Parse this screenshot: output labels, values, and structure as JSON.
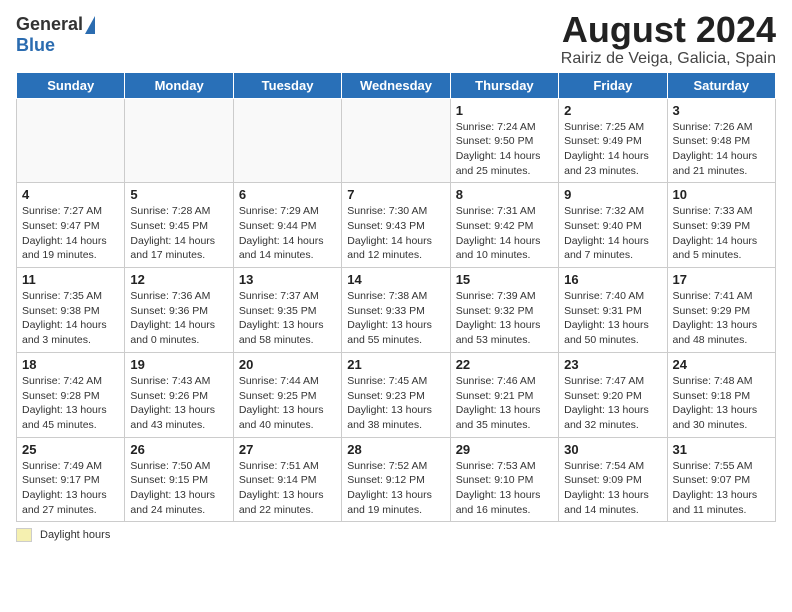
{
  "logo": {
    "general": "General",
    "blue": "Blue"
  },
  "title": "August 2024",
  "subtitle": "Rairiz de Veiga, Galicia, Spain",
  "weekdays": [
    "Sunday",
    "Monday",
    "Tuesday",
    "Wednesday",
    "Thursday",
    "Friday",
    "Saturday"
  ],
  "footer": {
    "daylight_label": "Daylight hours"
  },
  "weeks": [
    [
      {
        "day": "",
        "info": ""
      },
      {
        "day": "",
        "info": ""
      },
      {
        "day": "",
        "info": ""
      },
      {
        "day": "",
        "info": ""
      },
      {
        "day": "1",
        "info": "Sunrise: 7:24 AM\nSunset: 9:50 PM\nDaylight: 14 hours and 25 minutes."
      },
      {
        "day": "2",
        "info": "Sunrise: 7:25 AM\nSunset: 9:49 PM\nDaylight: 14 hours and 23 minutes."
      },
      {
        "day": "3",
        "info": "Sunrise: 7:26 AM\nSunset: 9:48 PM\nDaylight: 14 hours and 21 minutes."
      }
    ],
    [
      {
        "day": "4",
        "info": "Sunrise: 7:27 AM\nSunset: 9:47 PM\nDaylight: 14 hours and 19 minutes."
      },
      {
        "day": "5",
        "info": "Sunrise: 7:28 AM\nSunset: 9:45 PM\nDaylight: 14 hours and 17 minutes."
      },
      {
        "day": "6",
        "info": "Sunrise: 7:29 AM\nSunset: 9:44 PM\nDaylight: 14 hours and 14 minutes."
      },
      {
        "day": "7",
        "info": "Sunrise: 7:30 AM\nSunset: 9:43 PM\nDaylight: 14 hours and 12 minutes."
      },
      {
        "day": "8",
        "info": "Sunrise: 7:31 AM\nSunset: 9:42 PM\nDaylight: 14 hours and 10 minutes."
      },
      {
        "day": "9",
        "info": "Sunrise: 7:32 AM\nSunset: 9:40 PM\nDaylight: 14 hours and 7 minutes."
      },
      {
        "day": "10",
        "info": "Sunrise: 7:33 AM\nSunset: 9:39 PM\nDaylight: 14 hours and 5 minutes."
      }
    ],
    [
      {
        "day": "11",
        "info": "Sunrise: 7:35 AM\nSunset: 9:38 PM\nDaylight: 14 hours and 3 minutes."
      },
      {
        "day": "12",
        "info": "Sunrise: 7:36 AM\nSunset: 9:36 PM\nDaylight: 14 hours and 0 minutes."
      },
      {
        "day": "13",
        "info": "Sunrise: 7:37 AM\nSunset: 9:35 PM\nDaylight: 13 hours and 58 minutes."
      },
      {
        "day": "14",
        "info": "Sunrise: 7:38 AM\nSunset: 9:33 PM\nDaylight: 13 hours and 55 minutes."
      },
      {
        "day": "15",
        "info": "Sunrise: 7:39 AM\nSunset: 9:32 PM\nDaylight: 13 hours and 53 minutes."
      },
      {
        "day": "16",
        "info": "Sunrise: 7:40 AM\nSunset: 9:31 PM\nDaylight: 13 hours and 50 minutes."
      },
      {
        "day": "17",
        "info": "Sunrise: 7:41 AM\nSunset: 9:29 PM\nDaylight: 13 hours and 48 minutes."
      }
    ],
    [
      {
        "day": "18",
        "info": "Sunrise: 7:42 AM\nSunset: 9:28 PM\nDaylight: 13 hours and 45 minutes."
      },
      {
        "day": "19",
        "info": "Sunrise: 7:43 AM\nSunset: 9:26 PM\nDaylight: 13 hours and 43 minutes."
      },
      {
        "day": "20",
        "info": "Sunrise: 7:44 AM\nSunset: 9:25 PM\nDaylight: 13 hours and 40 minutes."
      },
      {
        "day": "21",
        "info": "Sunrise: 7:45 AM\nSunset: 9:23 PM\nDaylight: 13 hours and 38 minutes."
      },
      {
        "day": "22",
        "info": "Sunrise: 7:46 AM\nSunset: 9:21 PM\nDaylight: 13 hours and 35 minutes."
      },
      {
        "day": "23",
        "info": "Sunrise: 7:47 AM\nSunset: 9:20 PM\nDaylight: 13 hours and 32 minutes."
      },
      {
        "day": "24",
        "info": "Sunrise: 7:48 AM\nSunset: 9:18 PM\nDaylight: 13 hours and 30 minutes."
      }
    ],
    [
      {
        "day": "25",
        "info": "Sunrise: 7:49 AM\nSunset: 9:17 PM\nDaylight: 13 hours and 27 minutes."
      },
      {
        "day": "26",
        "info": "Sunrise: 7:50 AM\nSunset: 9:15 PM\nDaylight: 13 hours and 24 minutes."
      },
      {
        "day": "27",
        "info": "Sunrise: 7:51 AM\nSunset: 9:14 PM\nDaylight: 13 hours and 22 minutes."
      },
      {
        "day": "28",
        "info": "Sunrise: 7:52 AM\nSunset: 9:12 PM\nDaylight: 13 hours and 19 minutes."
      },
      {
        "day": "29",
        "info": "Sunrise: 7:53 AM\nSunset: 9:10 PM\nDaylight: 13 hours and 16 minutes."
      },
      {
        "day": "30",
        "info": "Sunrise: 7:54 AM\nSunset: 9:09 PM\nDaylight: 13 hours and 14 minutes."
      },
      {
        "day": "31",
        "info": "Sunrise: 7:55 AM\nSunset: 9:07 PM\nDaylight: 13 hours and 11 minutes."
      }
    ]
  ]
}
